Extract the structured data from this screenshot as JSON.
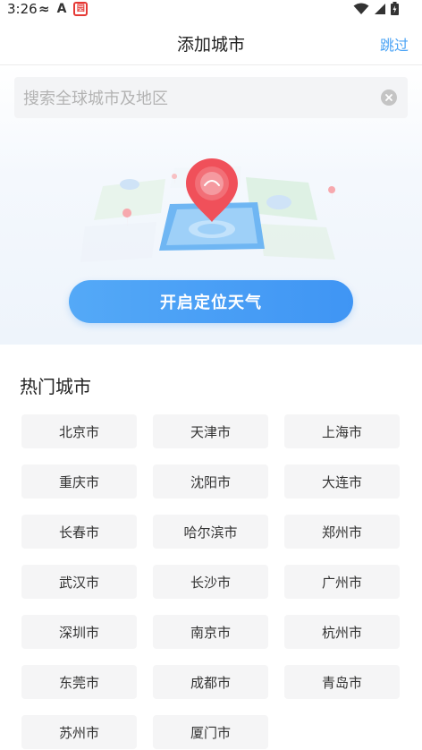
{
  "status_bar": {
    "time": "3:26",
    "left_icons": [
      "fire-icon",
      "a-icon",
      "app-notification-icon"
    ],
    "right_icons": [
      "wifi-icon",
      "signal-icon",
      "battery-icon"
    ],
    "red_icon_text": "园"
  },
  "header": {
    "title": "添加城市",
    "skip_label": "跳过"
  },
  "search": {
    "placeholder": "搜索全球城市及地区",
    "value": ""
  },
  "locate": {
    "button_label": "开启定位天气"
  },
  "hot_cities": {
    "title": "热门城市",
    "cities": [
      "北京市",
      "天津市",
      "上海市",
      "重庆市",
      "沈阳市",
      "大连市",
      "长春市",
      "哈尔滨市",
      "郑州市",
      "武汉市",
      "长沙市",
      "广州市",
      "深圳市",
      "南京市",
      "杭州市",
      "东莞市",
      "成都市",
      "青岛市",
      "苏州市",
      "厦门市"
    ]
  },
  "colors": {
    "accent": "#4aa3f5",
    "button": "#3f95f4",
    "pin": "#f0505a"
  }
}
